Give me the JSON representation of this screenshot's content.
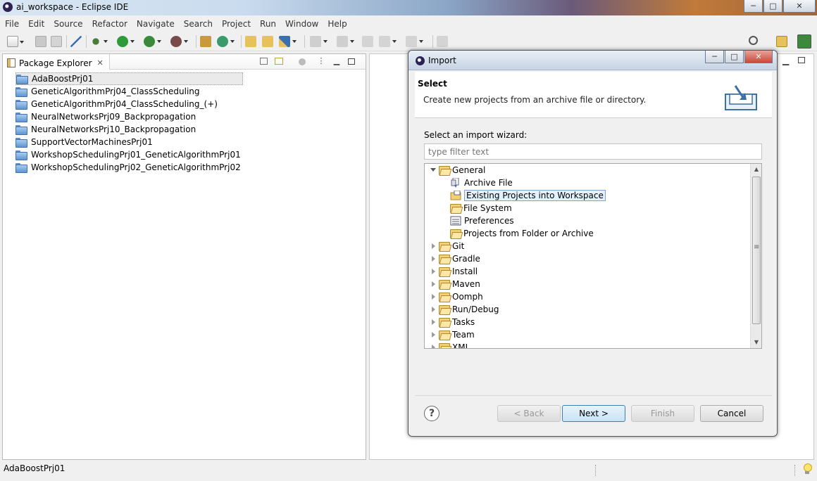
{
  "window": {
    "title": "ai_workspace - Eclipse IDE",
    "minimize": "─",
    "maximize": "□",
    "close": "✕"
  },
  "menu": [
    "File",
    "Edit",
    "Source",
    "Refactor",
    "Navigate",
    "Search",
    "Project",
    "Run",
    "Window",
    "Help"
  ],
  "explorer": {
    "tab_label": "Package Explorer",
    "close_glyph": "✕",
    "projects": [
      "AdaBoostPrj01",
      "GeneticAlgorithmPrj04_ClassScheduling",
      "GeneticAlgorithmPrj04_ClassScheduling_(+)",
      "NeuralNetworksPrj09_Backpropagation",
      "NeuralNetworksPrj10_Backpropagation",
      "SupportVectorMachinesPrj01",
      "WorkshopSchedulingPrj01_GeneticAlgorithmPrj01",
      "WorkshopSchedulingPrj02_GeneticAlgorithmPrj02"
    ],
    "selected_index": 0
  },
  "dialog": {
    "title": "Import",
    "heading": "Select",
    "description": "Create new projects from an archive file or directory.",
    "wizard_label": "Select an import wizard:",
    "filter_placeholder": "type filter text",
    "tree": {
      "general": {
        "label": "General",
        "expanded": true,
        "children": [
          "Archive File",
          "Existing Projects into Workspace",
          "File System",
          "Preferences",
          "Projects from Folder or Archive"
        ],
        "selected": "Existing Projects into Workspace"
      },
      "categories": [
        "Git",
        "Gradle",
        "Install",
        "Maven",
        "Oomph",
        "Run/Debug",
        "Tasks",
        "Team",
        "XML"
      ]
    },
    "buttons": {
      "help": "?",
      "back": "< Back",
      "next": "Next >",
      "finish": "Finish",
      "cancel": "Cancel"
    }
  },
  "status": {
    "text": "AdaBoostPrj01"
  },
  "colors": {
    "selection": "#e6f0fb",
    "selection_border": "#7da2ce",
    "default_button": "#c9e2f5"
  }
}
